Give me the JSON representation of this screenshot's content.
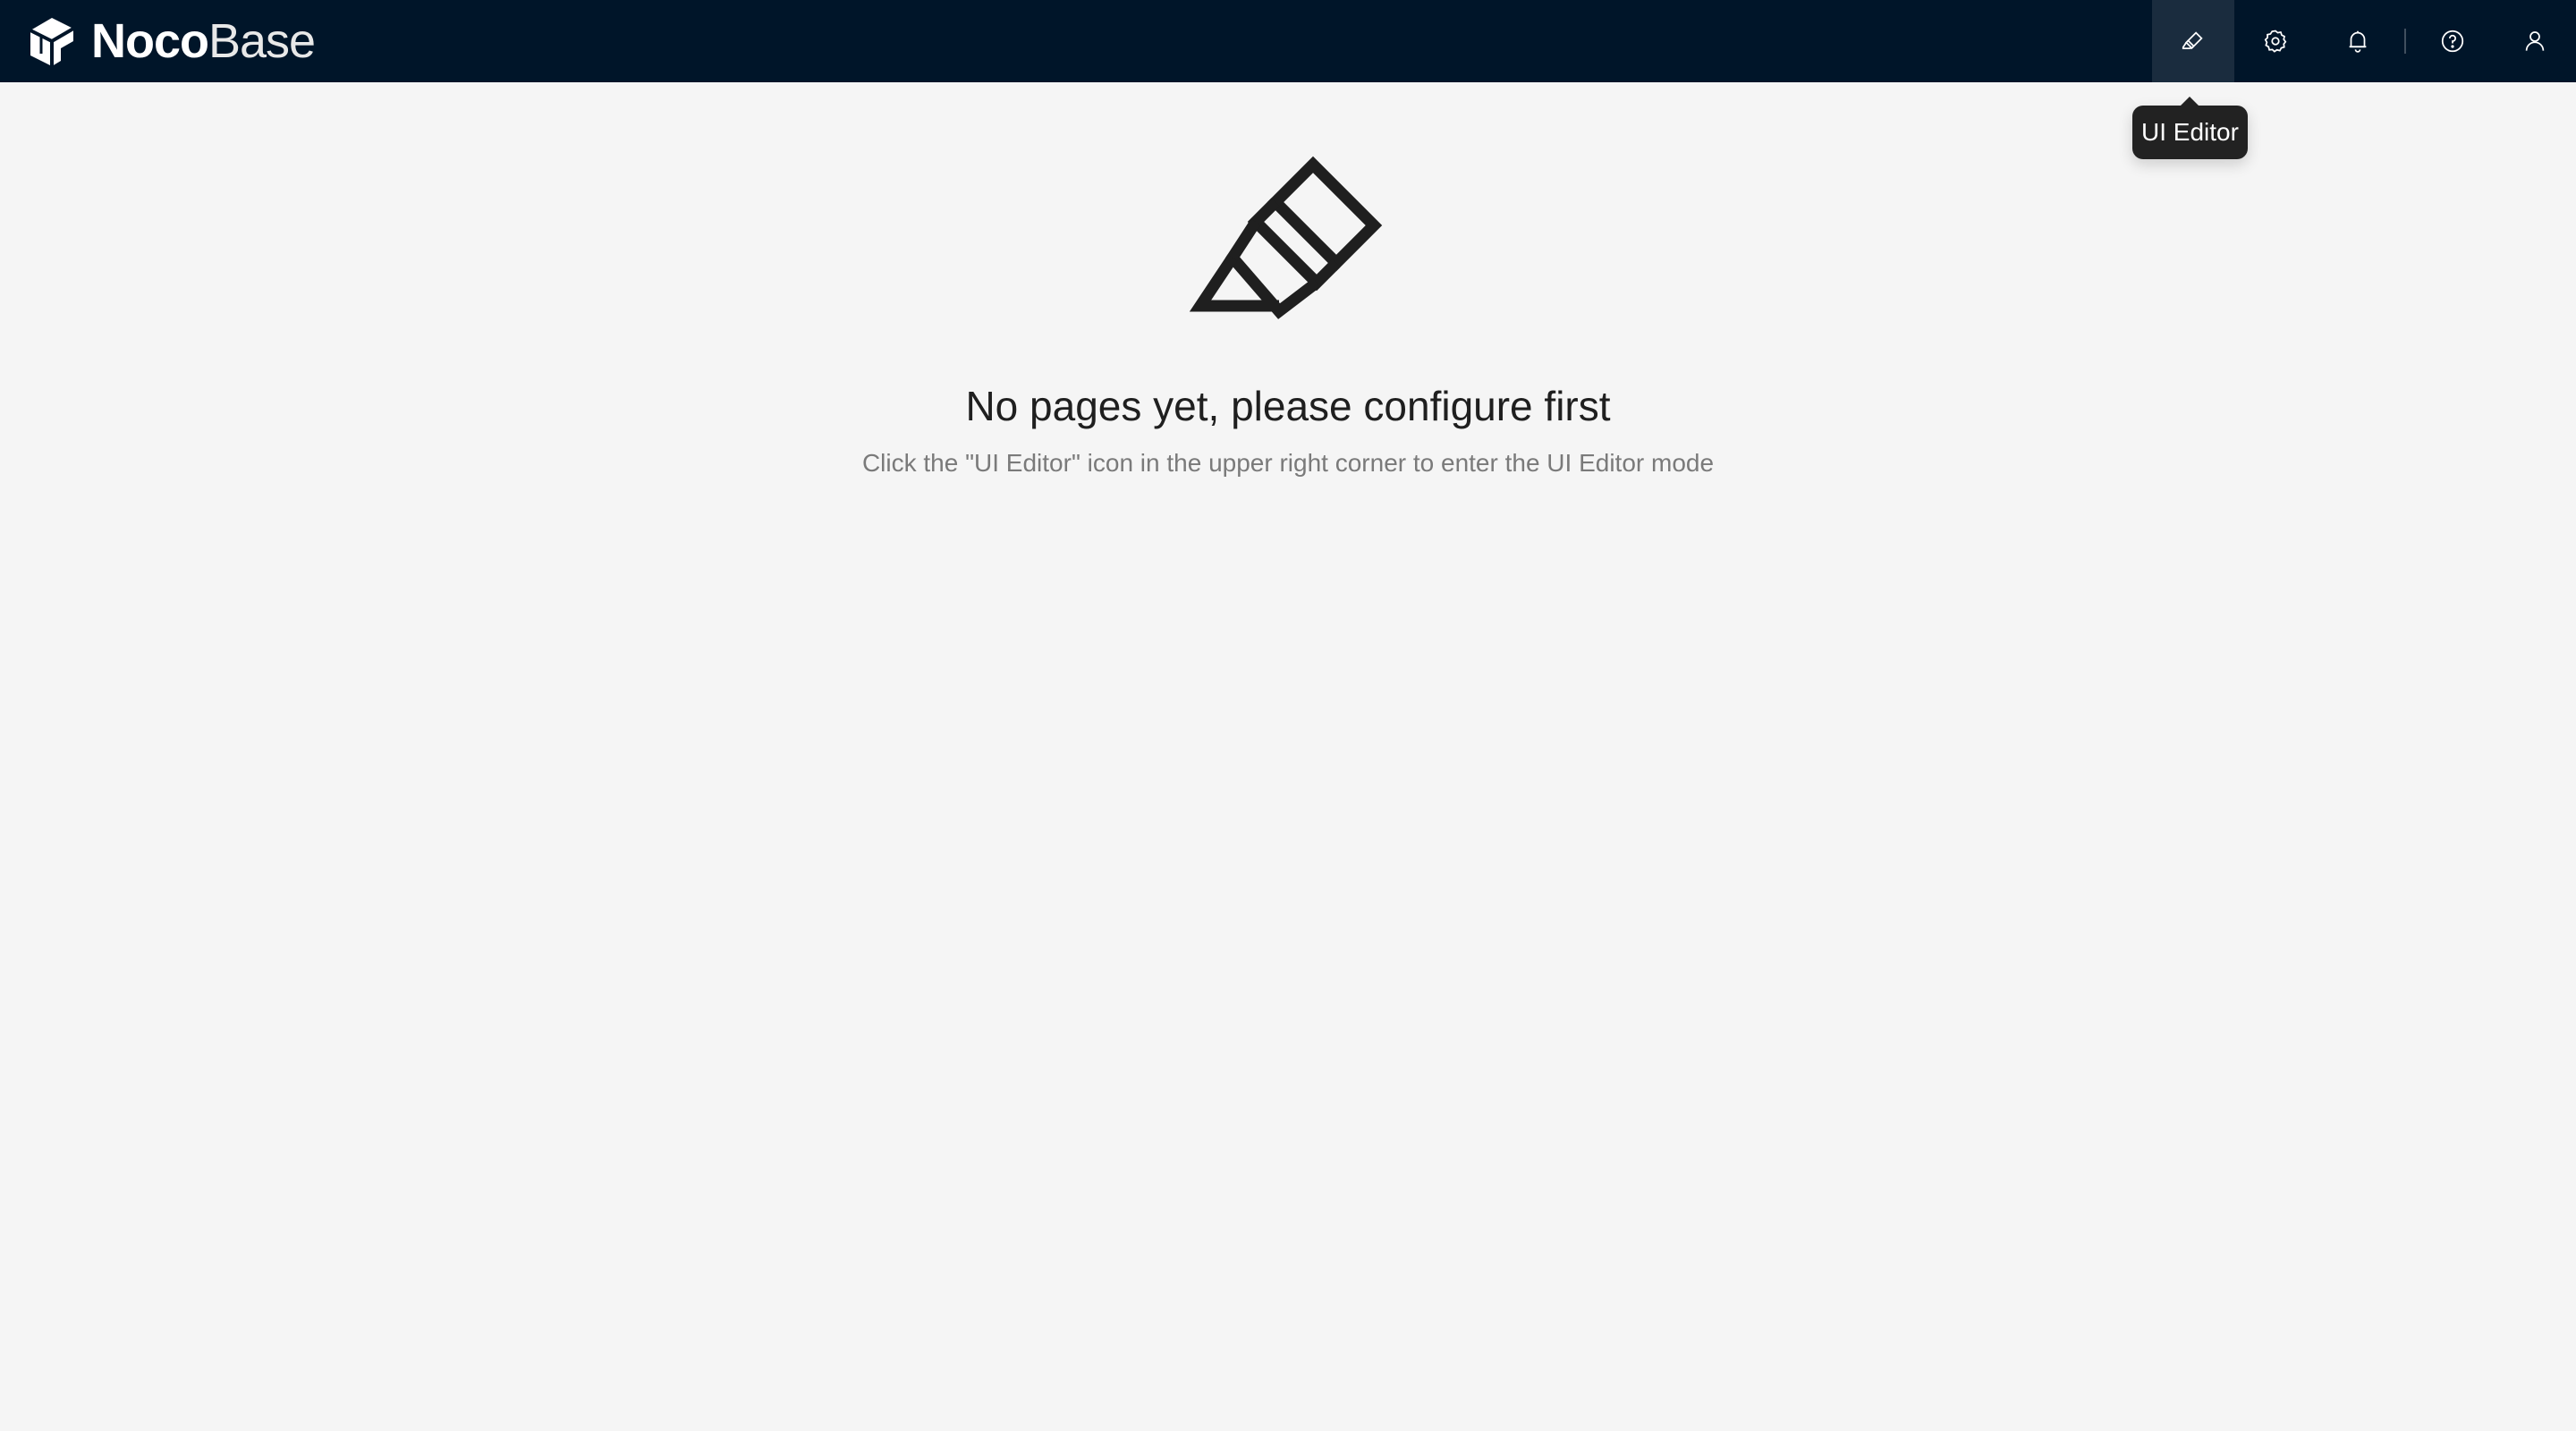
{
  "app": {
    "brand_bold": "Noco",
    "brand_light": "Base"
  },
  "toolbar": {
    "items": [
      {
        "icon": "highlighter-icon",
        "name": "ui-editor-button"
      },
      {
        "icon": "gear-icon",
        "name": "settings-button"
      },
      {
        "icon": "bell-icon",
        "name": "notifications-button"
      },
      {
        "icon": "question-circle-icon",
        "name": "help-button"
      },
      {
        "icon": "user-icon",
        "name": "user-menu-button"
      }
    ]
  },
  "tooltip": {
    "label": "UI Editor"
  },
  "empty_state": {
    "title": "No pages yet, please configure first",
    "description": "Click the \"UI Editor\" icon in the upper right corner to enter the UI Editor mode"
  },
  "colors": {
    "header_bg": "#001529",
    "page_bg": "#f5f5f5",
    "tooltip_bg": "#222222"
  }
}
